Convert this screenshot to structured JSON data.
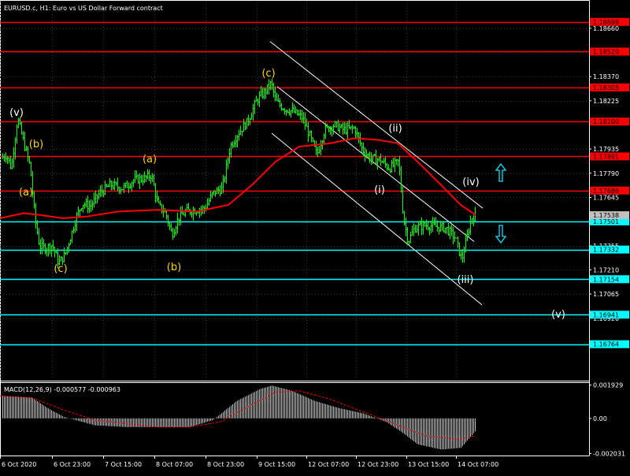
{
  "window": {
    "title": "EURUSD.c, H1:  Euro vs US Dollar Forward contract"
  },
  "colors": {
    "background": "#000000",
    "candle": "#00ff00",
    "moving_average": "#ff0000",
    "resistance": "#ff0000",
    "support": "#00ffff",
    "channel": "#ffffff",
    "macd_histogram": "#c0c0c0",
    "macd_signal": "#ff0000",
    "wave_yellow": "#ffd700",
    "wave_white": "#ffffff",
    "grid": "#3a3a3a"
  },
  "chart_data": [
    {
      "type": "candlestick",
      "title": "EURUSD.c, H1:  Euro vs US Dollar Forward contract",
      "ylim": [
        1.1655,
        1.1882
      ],
      "y_ticks": [
        "1.18660",
        "1.18515",
        "1.18370",
        "1.18225",
        "1.17935",
        "1.17790",
        "1.17645",
        "1.17355",
        "1.17210",
        "1.17065",
        "1.16920"
      ],
      "x_ticks": [
        "6 Oct 2020",
        "6 Oct 23:00",
        "7 Oct 15:00",
        "8 Oct 07:00",
        "8 Oct 23:00",
        "9 Oct 15:00",
        "12 Oct 07:00",
        "12 Oct 23:00",
        "13 Oct 15:00",
        "14 Oct 07:00"
      ],
      "price_path": [
        [
          0,
          1.1788
        ],
        [
          8,
          1.179
        ],
        [
          14,
          1.1782
        ],
        [
          22,
          1.1812
        ],
        [
          30,
          1.1797
        ],
        [
          38,
          1.1783
        ],
        [
          44,
          1.1752
        ],
        [
          50,
          1.1735
        ],
        [
          58,
          1.1734
        ],
        [
          66,
          1.1736
        ],
        [
          74,
          1.1725
        ],
        [
          82,
          1.173
        ],
        [
          90,
          1.1742
        ],
        [
          96,
          1.1752
        ],
        [
          104,
          1.1761
        ],
        [
          114,
          1.1759
        ],
        [
          126,
          1.1767
        ],
        [
          140,
          1.1772
        ],
        [
          156,
          1.177
        ],
        [
          170,
          1.1775
        ],
        [
          184,
          1.1776
        ],
        [
          192,
          1.1778
        ],
        [
          200,
          1.176
        ],
        [
          210,
          1.1755
        ],
        [
          218,
          1.1742
        ],
        [
          226,
          1.1752
        ],
        [
          236,
          1.1756
        ],
        [
          248,
          1.1757
        ],
        [
          260,
          1.1758
        ],
        [
          270,
          1.1767
        ],
        [
          282,
          1.177
        ],
        [
          292,
          1.1795
        ],
        [
          302,
          1.1803
        ],
        [
          314,
          1.181
        ],
        [
          326,
          1.1823
        ],
        [
          336,
          1.1828
        ],
        [
          344,
          1.1833
        ],
        [
          350,
          1.1822
        ],
        [
          360,
          1.1818
        ],
        [
          372,
          1.1816
        ],
        [
          384,
          1.1812
        ],
        [
          394,
          1.18
        ],
        [
          402,
          1.179
        ],
        [
          412,
          1.1805
        ],
        [
          424,
          1.1808
        ],
        [
          436,
          1.1805
        ],
        [
          450,
          1.1806
        ],
        [
          460,
          1.1793
        ],
        [
          470,
          1.1788
        ],
        [
          482,
          1.1787
        ],
        [
          494,
          1.1782
        ],
        [
          506,
          1.1786
        ],
        [
          512,
          1.1752
        ],
        [
          518,
          1.1738
        ],
        [
          526,
          1.1746
        ],
        [
          540,
          1.1748
        ],
        [
          552,
          1.1747
        ],
        [
          566,
          1.1746
        ],
        [
          578,
          1.174
        ],
        [
          586,
          1.1727
        ],
        [
          592,
          1.1739
        ],
        [
          598,
          1.1752
        ],
        [
          604,
          1.1754
        ]
      ],
      "moving_average": [
        [
          0,
          1.1752
        ],
        [
          30,
          1.1755
        ],
        [
          50,
          1.1754
        ],
        [
          80,
          1.1752
        ],
        [
          110,
          1.1753
        ],
        [
          150,
          1.1756
        ],
        [
          200,
          1.1757
        ],
        [
          250,
          1.1756
        ],
        [
          290,
          1.176
        ],
        [
          320,
          1.1772
        ],
        [
          350,
          1.1786
        ],
        [
          380,
          1.1795
        ],
        [
          420,
          1.1797
        ],
        [
          450,
          1.18
        ],
        [
          480,
          1.1799
        ],
        [
          505,
          1.1797
        ],
        [
          530,
          1.1786
        ],
        [
          560,
          1.1772
        ],
        [
          585,
          1.176
        ],
        [
          604,
          1.1754
        ]
      ],
      "resistance_levels": [
        "1.18698",
        "1.18520",
        "1.18305",
        "1.18100",
        "1.17891",
        "1.17686"
      ],
      "support_levels": [
        "1.17501",
        "1.17332",
        "1.17154",
        "1.16941",
        "1.16764"
      ],
      "current_price": "1.17538",
      "wave_labels": [
        {
          "text": "(v)",
          "color": "white"
        },
        {
          "text": "(b)",
          "color": "yellow"
        },
        {
          "text": "(a)",
          "color": "yellow"
        },
        {
          "text": "(c)",
          "color": "yellow"
        },
        {
          "text": "(a)",
          "color": "yellow"
        },
        {
          "text": "(b)",
          "color": "yellow"
        },
        {
          "text": "(c)",
          "color": "yellow"
        },
        {
          "text": "(ii)",
          "color": "white"
        },
        {
          "text": "(i)",
          "color": "white"
        },
        {
          "text": "(iv)",
          "color": "white"
        },
        {
          "text": "(iii)",
          "color": "white"
        },
        {
          "text": "(v)",
          "color": "white"
        }
      ]
    },
    {
      "type": "macd",
      "label": "MACD(12,26,9) -0.000577 -0.000963",
      "ylim": [
        -0.0021,
        0.002
      ],
      "y_ticks": [
        "0.001929",
        "0.00",
        "-0.002031"
      ],
      "histogram": [
        [
          0,
          0.0013
        ],
        [
          40,
          0.0012
        ],
        [
          60,
          0.0006
        ],
        [
          80,
          0.0001
        ],
        [
          120,
          -0.0004
        ],
        [
          160,
          -0.0005
        ],
        [
          200,
          -0.0005
        ],
        [
          240,
          -0.0005
        ],
        [
          270,
          -0.0001
        ],
        [
          300,
          0.001
        ],
        [
          330,
          0.0017
        ],
        [
          345,
          0.0019
        ],
        [
          370,
          0.0016
        ],
        [
          400,
          0.001
        ],
        [
          430,
          0.0006
        ],
        [
          460,
          0.0003
        ],
        [
          490,
          -0.0002
        ],
        [
          510,
          -0.0008
        ],
        [
          530,
          -0.0015
        ],
        [
          560,
          -0.0018
        ],
        [
          585,
          -0.0017
        ],
        [
          604,
          -0.0007
        ]
      ],
      "signal": [
        [
          0,
          0.0013
        ],
        [
          40,
          0.0012
        ],
        [
          80,
          0.0005
        ],
        [
          120,
          -0.0001
        ],
        [
          160,
          -0.0003
        ],
        [
          200,
          -0.0005
        ],
        [
          240,
          -0.0005
        ],
        [
          280,
          -0.0002
        ],
        [
          320,
          0.0008
        ],
        [
          350,
          0.0015
        ],
        [
          380,
          0.0016
        ],
        [
          420,
          0.0011
        ],
        [
          460,
          0.0004
        ],
        [
          500,
          -0.0003
        ],
        [
          540,
          -0.001
        ],
        [
          580,
          -0.0012
        ],
        [
          604,
          -0.001
        ]
      ]
    }
  ]
}
